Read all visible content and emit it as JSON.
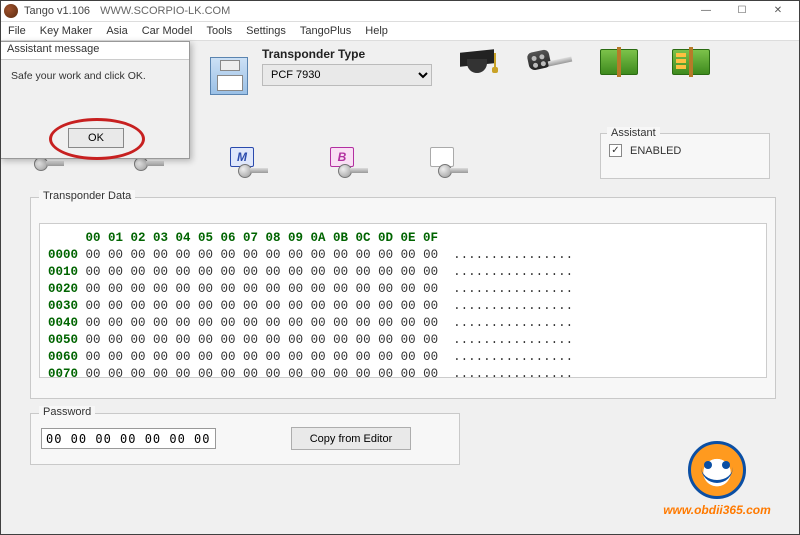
{
  "window": {
    "title": "Tango    v1.106",
    "url": "WWW.SCORPIO-LK.COM"
  },
  "menubar": [
    "File",
    "Key Maker",
    "Asia",
    "Car Model",
    "Tools",
    "Settings",
    "TangoPlus",
    "Help"
  ],
  "transponder_type": {
    "label": "Transponder Type",
    "selected": "PCF 7930"
  },
  "assistant_panel": {
    "legend": "Assistant",
    "enabled_label": "ENABLED",
    "checked": true
  },
  "key_tags": {
    "m": "M",
    "b": "B"
  },
  "transponder_data": {
    "legend": "Transponder Data",
    "header_cols": [
      "00",
      "01",
      "02",
      "03",
      "04",
      "05",
      "06",
      "07",
      "08",
      "09",
      "0A",
      "0B",
      "0C",
      "0D",
      "0E",
      "0F"
    ],
    "rows": [
      {
        "addr": "0000",
        "bytes": [
          "00",
          "00",
          "00",
          "00",
          "00",
          "00",
          "00",
          "00",
          "00",
          "00",
          "00",
          "00",
          "00",
          "00",
          "00",
          "00"
        ],
        "ascii": "................"
      },
      {
        "addr": "0010",
        "bytes": [
          "00",
          "00",
          "00",
          "00",
          "00",
          "00",
          "00",
          "00",
          "00",
          "00",
          "00",
          "00",
          "00",
          "00",
          "00",
          "00"
        ],
        "ascii": "................"
      },
      {
        "addr": "0020",
        "bytes": [
          "00",
          "00",
          "00",
          "00",
          "00",
          "00",
          "00",
          "00",
          "00",
          "00",
          "00",
          "00",
          "00",
          "00",
          "00",
          "00"
        ],
        "ascii": "................"
      },
      {
        "addr": "0030",
        "bytes": [
          "00",
          "00",
          "00",
          "00",
          "00",
          "00",
          "00",
          "00",
          "00",
          "00",
          "00",
          "00",
          "00",
          "00",
          "00",
          "00"
        ],
        "ascii": "................"
      },
      {
        "addr": "0040",
        "bytes": [
          "00",
          "00",
          "00",
          "00",
          "00",
          "00",
          "00",
          "00",
          "00",
          "00",
          "00",
          "00",
          "00",
          "00",
          "00",
          "00"
        ],
        "ascii": "................"
      },
      {
        "addr": "0050",
        "bytes": [
          "00",
          "00",
          "00",
          "00",
          "00",
          "00",
          "00",
          "00",
          "00",
          "00",
          "00",
          "00",
          "00",
          "00",
          "00",
          "00"
        ],
        "ascii": "................"
      },
      {
        "addr": "0060",
        "bytes": [
          "00",
          "00",
          "00",
          "00",
          "00",
          "00",
          "00",
          "00",
          "00",
          "00",
          "00",
          "00",
          "00",
          "00",
          "00",
          "00"
        ],
        "ascii": "................"
      },
      {
        "addr": "0070",
        "bytes": [
          "00",
          "00",
          "00",
          "00",
          "00",
          "00",
          "00",
          "00",
          "00",
          "00",
          "00",
          "00",
          "00",
          "00",
          "00",
          "00"
        ],
        "ascii": "................"
      }
    ]
  },
  "password": {
    "legend": "Password",
    "value": "00 00 00 00 00 00 00",
    "copy_label": "Copy from Editor"
  },
  "dialog": {
    "title": "Assistant message",
    "body": "Safe your work and click OK.",
    "ok_label": "OK"
  },
  "watermark": {
    "url": "www.obdii365.com"
  }
}
